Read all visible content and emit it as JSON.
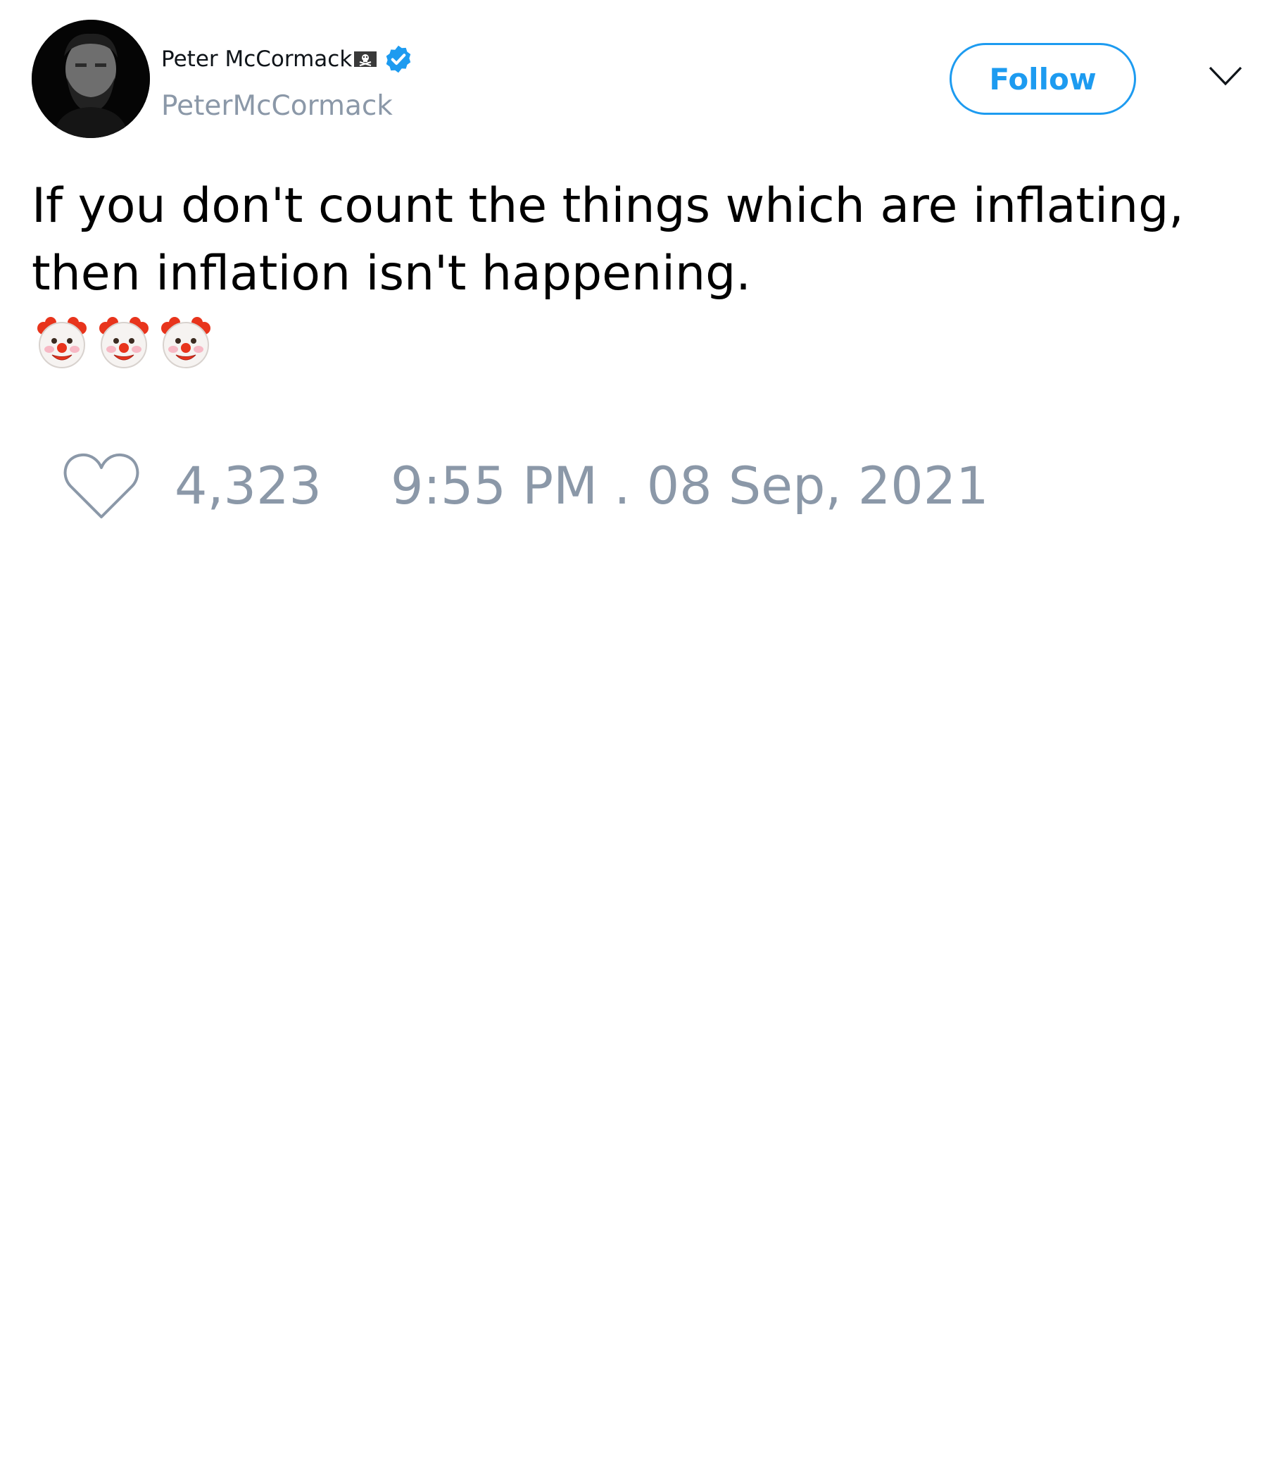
{
  "header": {
    "display_name": "Peter McCormack",
    "flag_icon": "pirate-flag-icon",
    "verified_icon": "verified-badge-icon",
    "handle": "PeterMcCormack",
    "follow_label": "Follow",
    "menu_icon": "chevron-down-icon"
  },
  "tweet": {
    "lines": [
      "If you don't count the things which are inflating,",
      "then inflation isn't happening."
    ],
    "emojis": [
      "clown-face-icon",
      "clown-face-icon",
      "clown-face-icon"
    ]
  },
  "footer": {
    "like_icon": "heart-icon",
    "like_count": "4,323",
    "timestamp": "9:55 PM . 08 Sep, 2021"
  },
  "colors": {
    "accent": "#1d9bf0",
    "muted": "#8b98a8",
    "text": "#000000",
    "background": "#ffffff"
  }
}
